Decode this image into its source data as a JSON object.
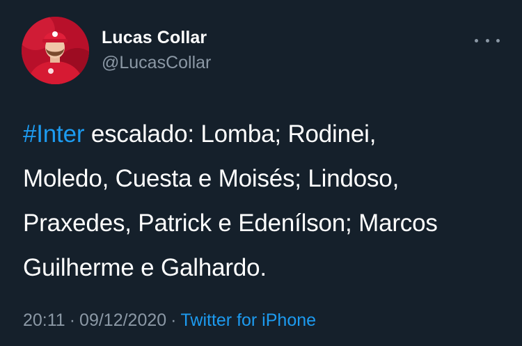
{
  "author": {
    "name": "Lucas Collar",
    "handle": "@LucasCollar"
  },
  "tweet": {
    "hashtag": "#Inter",
    "lines": [
      " escalado: Lomba; Rodinei,",
      "Moledo, Cuesta e Moisés; Lindoso,",
      "Praxedes, Patrick e Edenílson; Marcos",
      "Guilherme e Galhardo."
    ]
  },
  "meta": {
    "time": "20:11",
    "separator": "·",
    "date": "09/12/2020",
    "source": "Twitter for iPhone"
  },
  "icons": {
    "more": "more-options-icon",
    "avatar": "avatar-photo"
  },
  "colors": {
    "background": "#15202b",
    "link": "#1d9bf0",
    "secondary_text": "#8b98a5"
  }
}
